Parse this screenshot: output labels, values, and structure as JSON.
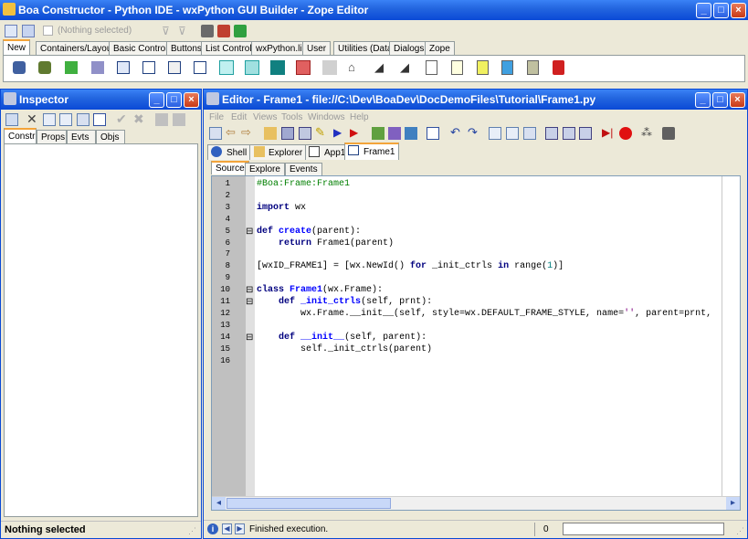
{
  "main_window": {
    "title": "Boa Constructor - Python IDE - wxPython GUI Builder - Zope Editor",
    "selection_text": "(Nothing selected)",
    "palette_tabs": [
      "New",
      "Containers/Layout",
      "Basic Controls",
      "Buttons",
      "List Controls",
      "wxPython.lib",
      "User",
      "Utilities (Data)",
      "Dialogs",
      "Zope"
    ],
    "active_tab": "New"
  },
  "inspector": {
    "title": "Inspector",
    "tabs": [
      "Constr",
      "Props",
      "Evts",
      "Objs"
    ],
    "status": "Nothing selected"
  },
  "editor": {
    "title": "Editor - Frame1 - file://C:\\Dev\\BoaDev\\DocDemoFiles\\Tutorial\\Frame1.py",
    "menu": [
      "File",
      "Edit",
      "Views",
      "Tools",
      "Windows",
      "Help"
    ],
    "doc_tabs": [
      "Shell",
      "Explorer",
      "App1",
      "Frame1"
    ],
    "view_tabs": [
      "Source",
      "Explore",
      "Events"
    ],
    "code_lines": [
      {
        "n": "1",
        "fold": "",
        "segs": [
          [
            "#Boa:Frame:Frame1",
            "comment"
          ]
        ]
      },
      {
        "n": "2",
        "fold": "",
        "segs": []
      },
      {
        "n": "3",
        "fold": "",
        "segs": [
          [
            "import",
            "kw"
          ],
          [
            " wx",
            "plain"
          ]
        ]
      },
      {
        "n": "4",
        "fold": "",
        "segs": []
      },
      {
        "n": "5",
        "fold": "⊟",
        "segs": [
          [
            "def",
            "kw"
          ],
          [
            " ",
            "plain"
          ],
          [
            "create",
            "def"
          ],
          [
            "(parent):",
            "plain"
          ]
        ]
      },
      {
        "n": "6",
        "fold": "",
        "segs": [
          [
            "    ",
            "plain"
          ],
          [
            "return",
            "kw"
          ],
          [
            " Frame1(parent)",
            "plain"
          ]
        ]
      },
      {
        "n": "7",
        "fold": "",
        "segs": []
      },
      {
        "n": "8",
        "fold": "",
        "segs": [
          [
            "[wxID_FRAME1] = [wx.NewId() ",
            "plain"
          ],
          [
            "for",
            "kw"
          ],
          [
            " _init_ctrls ",
            "plain"
          ],
          [
            "in",
            "kw"
          ],
          [
            " range(",
            "plain"
          ],
          [
            "1",
            "num"
          ],
          [
            ")]",
            "plain"
          ]
        ]
      },
      {
        "n": "9",
        "fold": "",
        "segs": []
      },
      {
        "n": "10",
        "fold": "⊟",
        "segs": [
          [
            "class",
            "kw"
          ],
          [
            " ",
            "plain"
          ],
          [
            "Frame1",
            "def"
          ],
          [
            "(wx.Frame):",
            "plain"
          ]
        ]
      },
      {
        "n": "11",
        "fold": "⊟",
        "segs": [
          [
            "    ",
            "plain"
          ],
          [
            "def",
            "kw"
          ],
          [
            " ",
            "plain"
          ],
          [
            "_init_ctrls",
            "def"
          ],
          [
            "(self, prnt):",
            "plain"
          ]
        ]
      },
      {
        "n": "12",
        "fold": "",
        "segs": [
          [
            "        wx.Frame.__init__(self, style=wx.DEFAULT_FRAME_STYLE, name=",
            "plain"
          ],
          [
            "''",
            "str"
          ],
          [
            ", parent=prnt,",
            "plain"
          ]
        ]
      },
      {
        "n": "13",
        "fold": "",
        "segs": []
      },
      {
        "n": "14",
        "fold": "⊟",
        "segs": [
          [
            "    ",
            "plain"
          ],
          [
            "def",
            "kw"
          ],
          [
            " ",
            "plain"
          ],
          [
            "__init__",
            "def"
          ],
          [
            "(self, parent):",
            "plain"
          ]
        ]
      },
      {
        "n": "15",
        "fold": "",
        "segs": [
          [
            "        self._init_ctrls(parent)",
            "plain"
          ]
        ]
      },
      {
        "n": "16",
        "fold": "",
        "segs": []
      }
    ],
    "status_text": "Finished execution.",
    "status_num": "0"
  },
  "colors": {
    "keyword": "#00007f",
    "comment": "#007f00",
    "string": "#7f007f",
    "number": "#007f7f",
    "def": "#0000ff"
  }
}
